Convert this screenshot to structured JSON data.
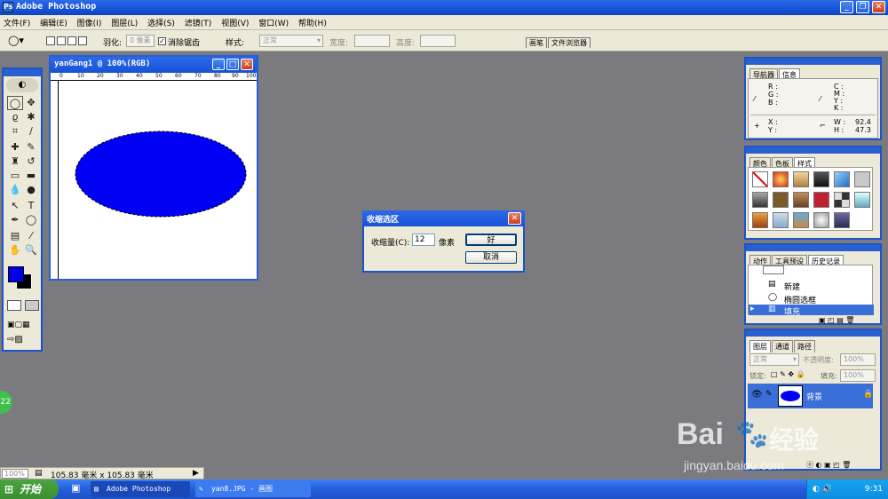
{
  "app": {
    "title": "Adobe Photoshop"
  },
  "menu": [
    "文件(F)",
    "编辑(E)",
    "图像(I)",
    "图层(L)",
    "选择(S)",
    "滤镜(T)",
    "视图(V)",
    "窗口(W)",
    "帮助(H)"
  ],
  "options": {
    "feather_label": "羽化:",
    "feather_value": "0 像素",
    "antialias_label": "消除锯齿",
    "style_label": "样式:",
    "style_value": "正常",
    "width_label": "宽度:",
    "height_label": "高度:",
    "tab_brush": "画笔",
    "tab_browser": "文件浏览器"
  },
  "document": {
    "title": "yanGang1 @ 100%(RGB)",
    "ruler_labels": [
      "0",
      "10",
      "20",
      "30",
      "40",
      "50",
      "60",
      "70",
      "80",
      "90",
      "100"
    ],
    "ellipse_color": "#0000f5"
  },
  "dialog": {
    "title": "收缩选区",
    "amount_label": "收缩量(C):",
    "amount_value": "12",
    "unit": "像素",
    "ok": "好",
    "cancel": "取消"
  },
  "navigator_panel": {
    "tabs": [
      "导航器",
      "信息"
    ],
    "r": "R :",
    "g": "G :",
    "b": "B :",
    "c": "C :",
    "m": "M :",
    "y": "Y :",
    "k": "K :",
    "x": "X :",
    "y2": "Y :",
    "w": "W :",
    "w_value": "92.4",
    "h": "H :",
    "h_value": "47.3"
  },
  "swatch_panel": {
    "tabs": [
      "颜色",
      "色板",
      "样式"
    ]
  },
  "history_panel": {
    "tabs": [
      "动作",
      "工具预设",
      "历史记录"
    ],
    "items": [
      "新建",
      "椭圆选框",
      "填充"
    ]
  },
  "layers_panel": {
    "tabs": [
      "图层",
      "通道",
      "路径"
    ],
    "blend_mode": "正常",
    "opacity_label": "不透明度:",
    "opacity_value": "100%",
    "lock_label": "锁定:",
    "fill_label": "填充:",
    "fill_value": "100%",
    "layer_name": "背景"
  },
  "status": {
    "zoom": "100%",
    "doc_size": "105.83 毫米 x 105.83 毫米"
  },
  "badge": "22",
  "watermark": {
    "brand": "Bai",
    "brand2": "经验",
    "url": "jingyan.baidu.com"
  },
  "taskbar": {
    "start": "开始",
    "items": [
      "Adobe Photoshop",
      "yan8.JPG - 画图"
    ],
    "clock": "9:31"
  },
  "colors": {
    "foreground": "#0000e6",
    "selection_accent": "#3a6ed8"
  }
}
